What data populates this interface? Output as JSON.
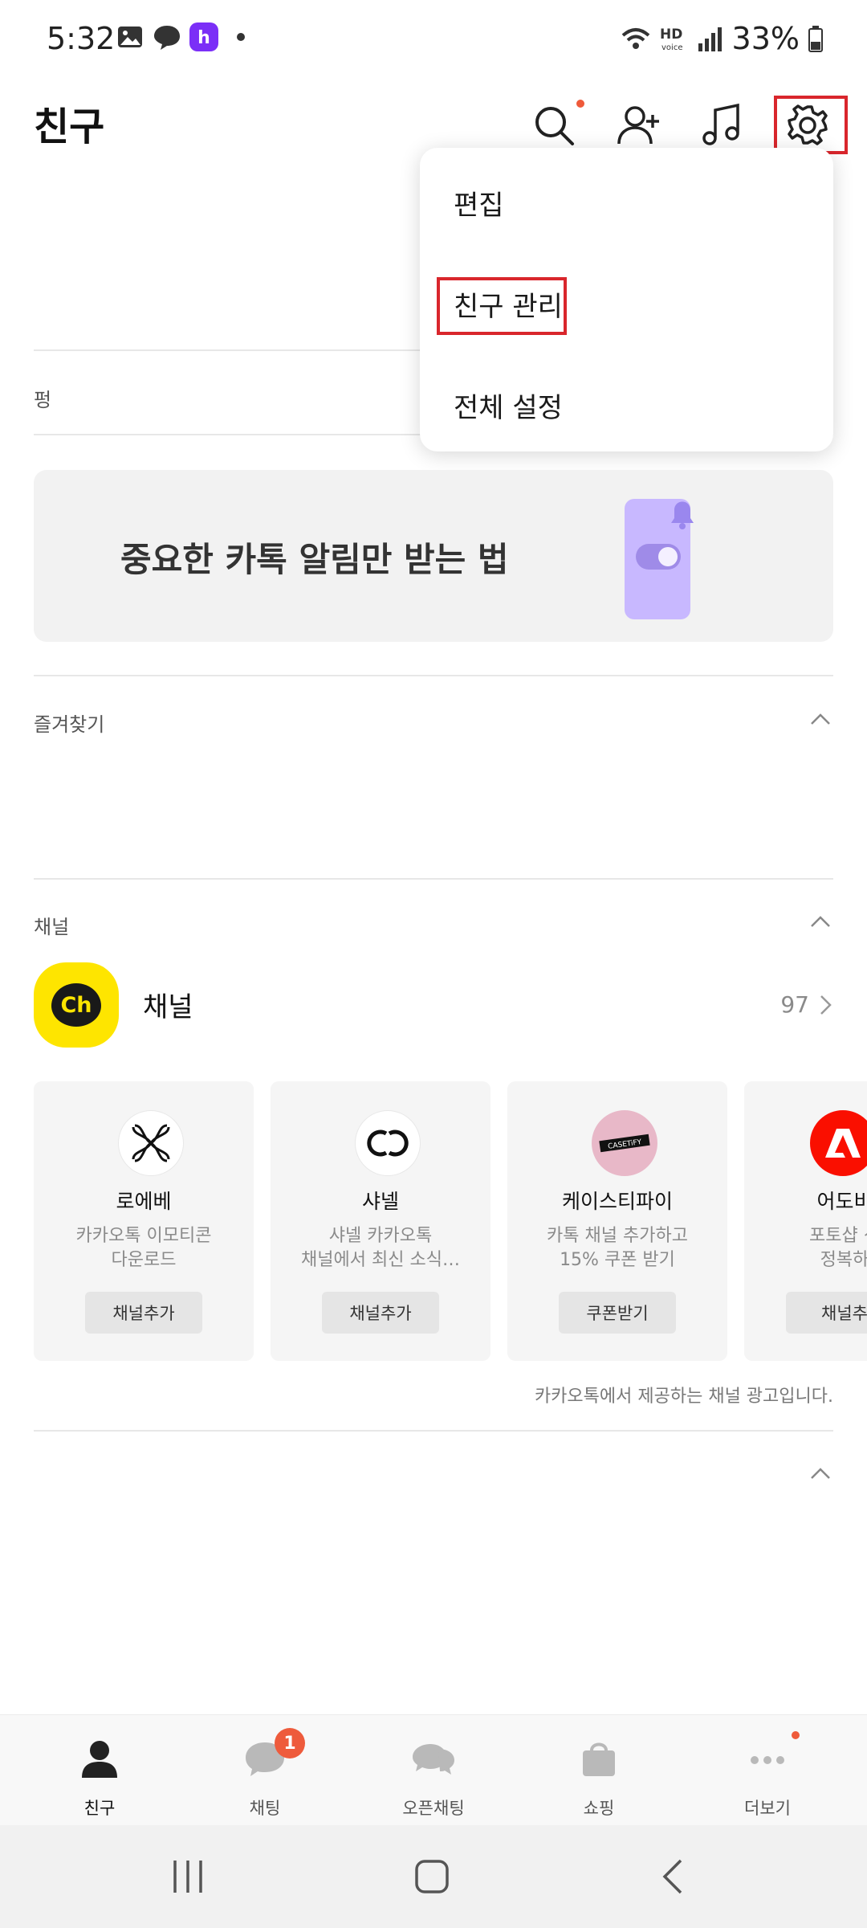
{
  "status_bar": {
    "time": "5:32",
    "battery": "33%",
    "hd_voice": "HD"
  },
  "header": {
    "title": "친구",
    "icons": [
      "search-icon",
      "add-friend-icon",
      "music-icon",
      "settings-icon"
    ]
  },
  "menu": {
    "items": [
      {
        "label": "편집"
      },
      {
        "label": "친구 관리"
      },
      {
        "label": "전체 설정"
      }
    ]
  },
  "profile_section": {
    "label": "펑"
  },
  "banner": {
    "text": "중요한 카톡 알림만 받는 법"
  },
  "favorites": {
    "label": "즐겨찾기"
  },
  "channels": {
    "section_label": "채널",
    "row_name": "채널",
    "count": "97",
    "logo_text": "Ch",
    "cards": [
      {
        "name": "로에베",
        "desc_line1": "카카오톡 이모티콘",
        "desc_line2": "다운로드",
        "button": "채널추가"
      },
      {
        "name": "샤넬",
        "desc_line1": "샤넬 카카오톡",
        "desc_line2": "채널에서 최신 소식…",
        "button": "채널추가"
      },
      {
        "name": "케이스티파이",
        "desc_line1": "카톡 채널 추가하고",
        "desc_line2": "15% 쿠폰 받기",
        "button": "쿠폰받기",
        "logo_text": "CASETiFY"
      },
      {
        "name": "어도비",
        "desc_line1": "포토샵 신",
        "desc_line2": "정복하",
        "button": "채널추"
      }
    ],
    "ad_note": "카카오톡에서 제공하는 채널 광고입니다."
  },
  "bottom_nav": {
    "items": [
      {
        "label": "친구",
        "icon": "person-icon",
        "active": true
      },
      {
        "label": "채팅",
        "icon": "chat-bubble-icon",
        "badge": "1"
      },
      {
        "label": "오픈채팅",
        "icon": "open-chat-icon"
      },
      {
        "label": "쇼핑",
        "icon": "shopping-bag-icon"
      },
      {
        "label": "더보기",
        "icon": "more-dots-icon"
      }
    ]
  },
  "colors": {
    "accent_red": "#d9262c",
    "notification_dot": "#ef5a3a",
    "kakao_yellow": "#fee500",
    "banner_bg": "#f2f2f2",
    "phone_purple": "#c8b8ff"
  }
}
